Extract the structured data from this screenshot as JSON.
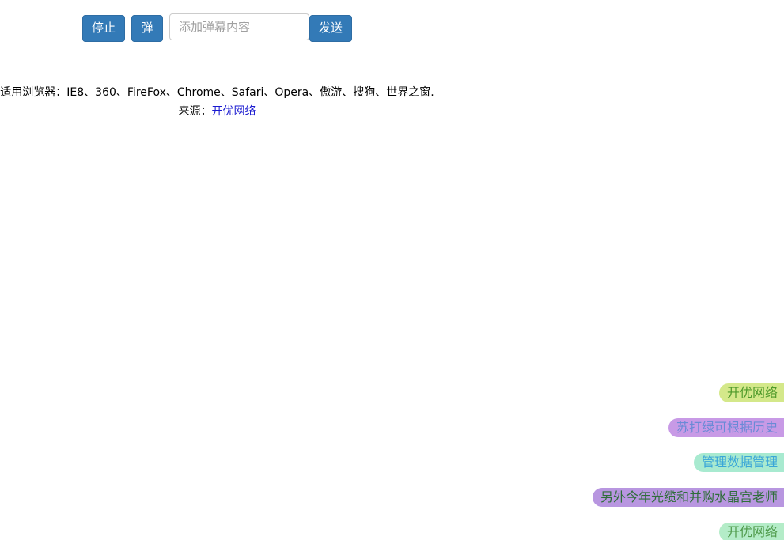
{
  "toolbar": {
    "stop_label": "停止",
    "shoot_label": "弹",
    "input_placeholder": "添加弹幕内容",
    "input_value": "",
    "send_label": "发送"
  },
  "info": {
    "browsers": "适用浏览器：IE8、360、FireFox、Chrome、Safari、Opera、傲游、搜狗、世界之窗.",
    "source_label": "来源：",
    "source_link": "开优网络"
  },
  "danmu": [
    {
      "text": "开优网络",
      "bg": "#d4e88a",
      "color": "#4e9a2a"
    },
    {
      "text": "苏打绿可根据历史",
      "bg": "#c89ae6",
      "color": "#6a8ad6"
    },
    {
      "text": "管理数据管理",
      "bg": "#a8ead0",
      "color": "#3aa6d8"
    },
    {
      "text": "另外今年光缆和并购水晶宫老师",
      "bg": "#b896e0",
      "color": "#2f6e3a"
    },
    {
      "text": "开优网络",
      "bg": "#b4ecc8",
      "color": "#4e9a4a"
    }
  ]
}
